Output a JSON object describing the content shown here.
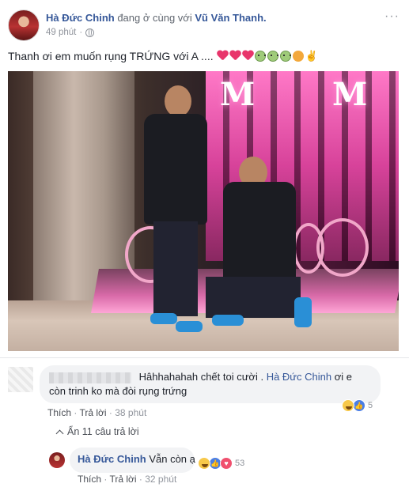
{
  "post": {
    "author": "Hà Đức Chinh",
    "with_text": "đang ở cùng với",
    "tagged": "Vũ Văn Thanh.",
    "time": "49 phút",
    "separator": "·",
    "more": "···",
    "text": "Thanh ơi em muốn rụng TRỨNG với A ...."
  },
  "comment": {
    "text_intro": "Hâhhahahah chết toi cười .",
    "mention": "Hà Đức Chinh",
    "text_rest": "ơi e còn trinh ko mà đòi rụng trứng",
    "like": "Thích",
    "reply": "Trả lời",
    "time": "38 phút",
    "reactions_count": "5"
  },
  "hide_replies": "Ẩn 11 câu trả lời",
  "reply": {
    "author": "Hà Đức Chinh",
    "text": "Vẫn còn ạ",
    "like": "Thích",
    "reply": "Trả lời",
    "time": "32 phút",
    "reactions_count": "53"
  },
  "photo": {
    "sign_letter": "M"
  }
}
